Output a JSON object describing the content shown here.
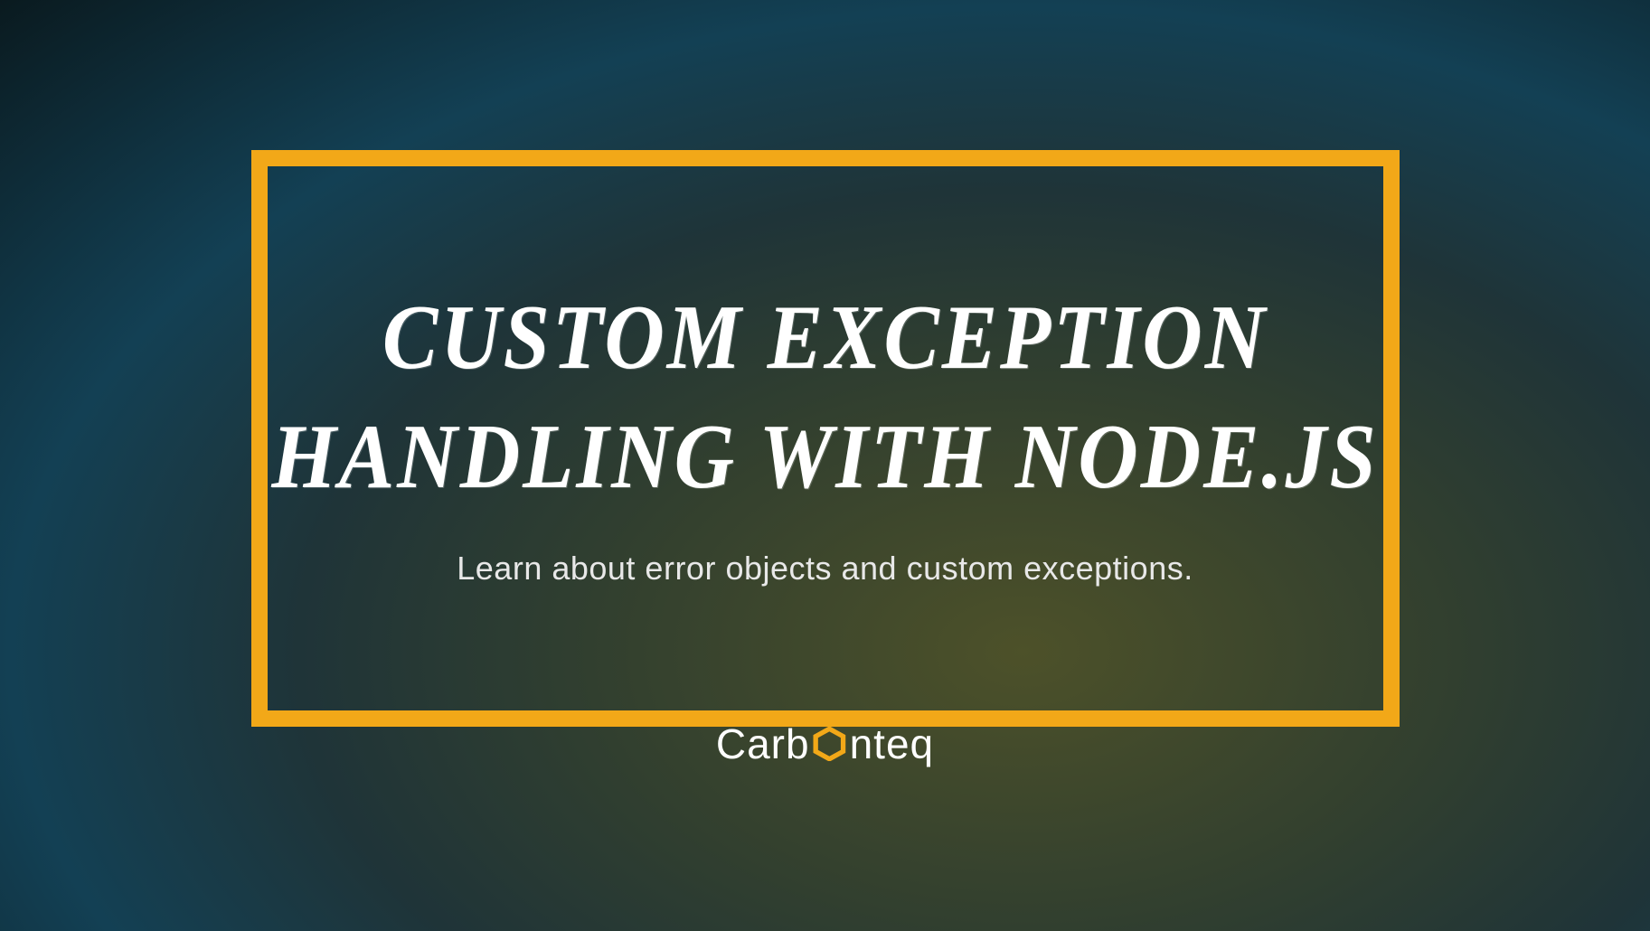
{
  "title": "CUSTOM EXCEPTION HANDLING WITH NODE.JS",
  "subtitle": "Learn about error objects and custom exceptions.",
  "brand": {
    "prefix": "Carb",
    "suffix": "nteq"
  },
  "colors": {
    "frame": "#f2a818",
    "hexOuter": "#f2a818",
    "hexInner": "#1a2a2e"
  }
}
